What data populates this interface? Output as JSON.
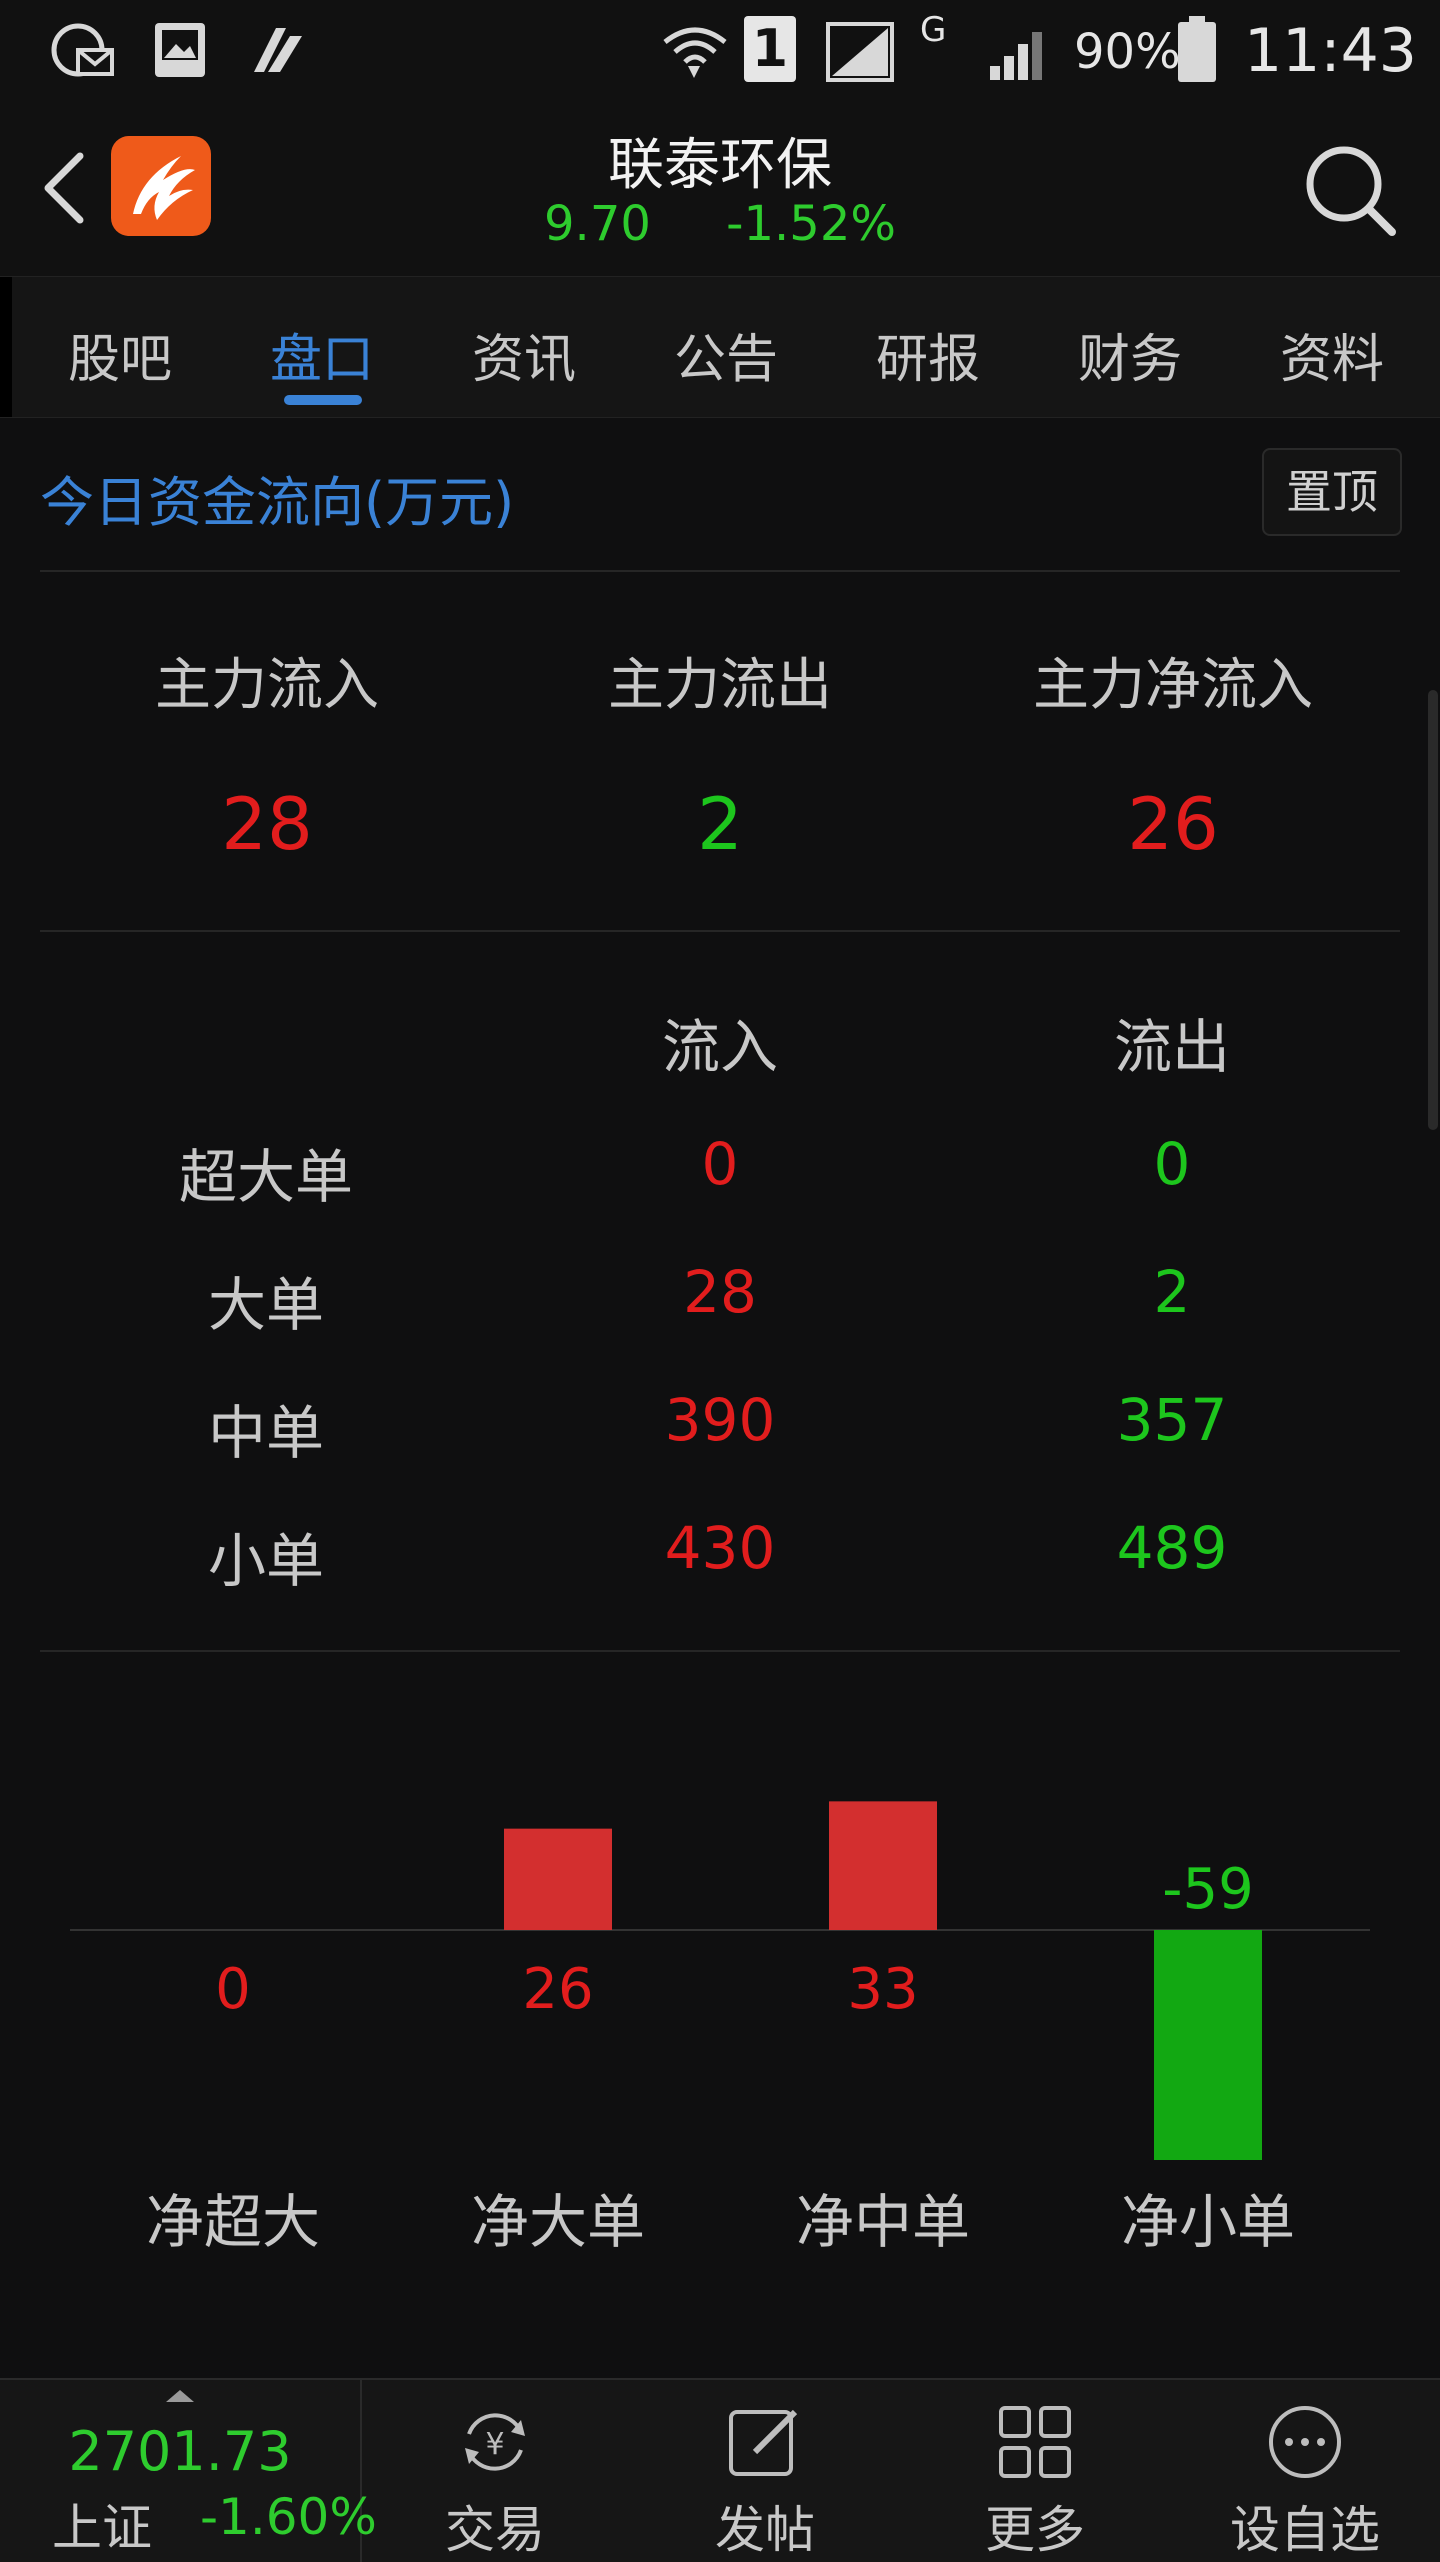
{
  "status_bar": {
    "sim_label": "1",
    "network_label": "G",
    "battery": "90%",
    "time": "11:43"
  },
  "header": {
    "title": "联泰环保",
    "price": "9.70",
    "change_pct": "-1.52%"
  },
  "tabs": [
    {
      "label": "股吧"
    },
    {
      "label": "盘口"
    },
    {
      "label": "资讯"
    },
    {
      "label": "公告"
    },
    {
      "label": "研报"
    },
    {
      "label": "财务"
    },
    {
      "label": "资料"
    }
  ],
  "active_tab": "盘口",
  "section": {
    "title": "今日资金流向(万元)",
    "pin_label": "置顶"
  },
  "summary": [
    {
      "label": "主力流入",
      "value": "28",
      "color": "#e21d1d"
    },
    {
      "label": "主力流出",
      "value": "2",
      "color": "#1dc61d"
    },
    {
      "label": "主力净流入",
      "value": "26",
      "color": "#e21d1d"
    }
  ],
  "flow_table": {
    "headers": [
      "流入",
      "流出"
    ],
    "rows": [
      {
        "label": "超大单",
        "in": "0",
        "out": "0"
      },
      {
        "label": "大单",
        "in": "28",
        "out": "2"
      },
      {
        "label": "中单",
        "in": "390",
        "out": "357"
      },
      {
        "label": "小单",
        "in": "430",
        "out": "489"
      }
    ]
  },
  "chart_data": {
    "type": "bar",
    "categories": [
      "净超大",
      "净大单",
      "净中单",
      "净小单"
    ],
    "values": [
      0,
      26,
      33,
      -59
    ],
    "positive_color": "#d32f2f",
    "negative_color": "#12a812"
  },
  "bottom_bar": {
    "index_value": "2701.73",
    "index_name": "上证",
    "index_change": "-1.60%",
    "nav": [
      {
        "label": "交易",
        "icon": "yen-exchange-icon"
      },
      {
        "label": "发帖",
        "icon": "edit-post-icon"
      },
      {
        "label": "更多",
        "icon": "grid-more-icon"
      },
      {
        "label": "设自选",
        "icon": "more-dots-icon"
      }
    ]
  }
}
